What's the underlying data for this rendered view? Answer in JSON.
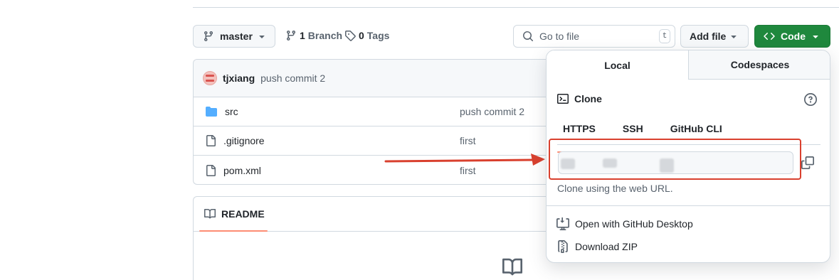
{
  "toolbar": {
    "branch_label": "master",
    "branches_count": "1",
    "branches_label": "Branch",
    "tags_count": "0",
    "tags_label": "Tags",
    "search_placeholder": "Go to file",
    "search_shortcut": "t",
    "add_file_label": "Add file",
    "code_label": "Code"
  },
  "latest_commit": {
    "author": "tjxiang",
    "message": "push commit 2"
  },
  "files": [
    {
      "name": "src",
      "type": "folder",
      "commit_message": "push commit 2"
    },
    {
      "name": ".gitignore",
      "type": "file",
      "commit_message": "first"
    },
    {
      "name": "pom.xml",
      "type": "file",
      "commit_message": "first"
    }
  ],
  "readme": {
    "tab_label": "README"
  },
  "clone_popover": {
    "tabs": [
      "Local",
      "Codespaces"
    ],
    "active_tab": "Local",
    "clone_title": "Clone",
    "protocols": [
      "HTTPS",
      "SSH",
      "GitHub CLI"
    ],
    "active_protocol": "HTTPS",
    "url_value": "",
    "hint": "Clone using the web URL.",
    "actions": [
      {
        "label": "Open with GitHub Desktop",
        "icon": "desktop-download-icon"
      },
      {
        "label": "Download ZIP",
        "icon": "file-zip-icon"
      }
    ]
  },
  "colors": {
    "accent_green": "#1f883d",
    "tab_underline": "#fd8c73",
    "annotation_red": "#d9402e",
    "folder_blue": "#54aeff"
  }
}
